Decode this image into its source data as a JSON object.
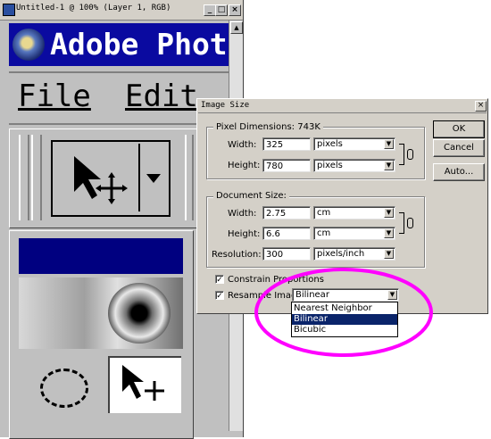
{
  "ps_window": {
    "title": "Untitled-1 @ 100% (Layer 1, RGB)",
    "minimize": "_",
    "maximize": "□",
    "close": "×",
    "banner_text": "Adobe Phot",
    "menu": [
      "File",
      "Edit"
    ],
    "colors": {
      "banner_bg": "#0a0aa0",
      "panel": "#c0c0c0",
      "titlebar": "#d4d0c8"
    }
  },
  "dialog": {
    "title": "Image Size",
    "close": "×",
    "pixel_dimensions": {
      "legend": "Pixel Dimensions:",
      "size": "743K"
    },
    "width": {
      "label": "Width:",
      "value": "325",
      "unit": "pixels"
    },
    "height": {
      "label": "Height:",
      "value": "780",
      "unit": "pixels"
    },
    "document_size": {
      "legend": "Document Size:"
    },
    "doc_width": {
      "label": "Width:",
      "value": "2.75",
      "unit": "cm"
    },
    "doc_height": {
      "label": "Height:",
      "value": "6.6",
      "unit": "cm"
    },
    "resolution": {
      "label": "Resolution:",
      "value": "300",
      "unit": "pixels/inch"
    },
    "constrain": {
      "label": "Constrain Proportions",
      "checked": true
    },
    "resample": {
      "label": "Resample Image:",
      "checked": true,
      "value": "Bilinear"
    },
    "resample_options": [
      "Nearest Neighbor",
      "Bilinear",
      "Bicubic"
    ],
    "selected_option": "Bilinear",
    "buttons": {
      "ok": "OK",
      "cancel": "Cancel",
      "auto": "Auto..."
    },
    "colors": {
      "titlebar": "#d4d0c8",
      "highlight": "#0a246a",
      "annotation": "#ff00ff"
    }
  }
}
